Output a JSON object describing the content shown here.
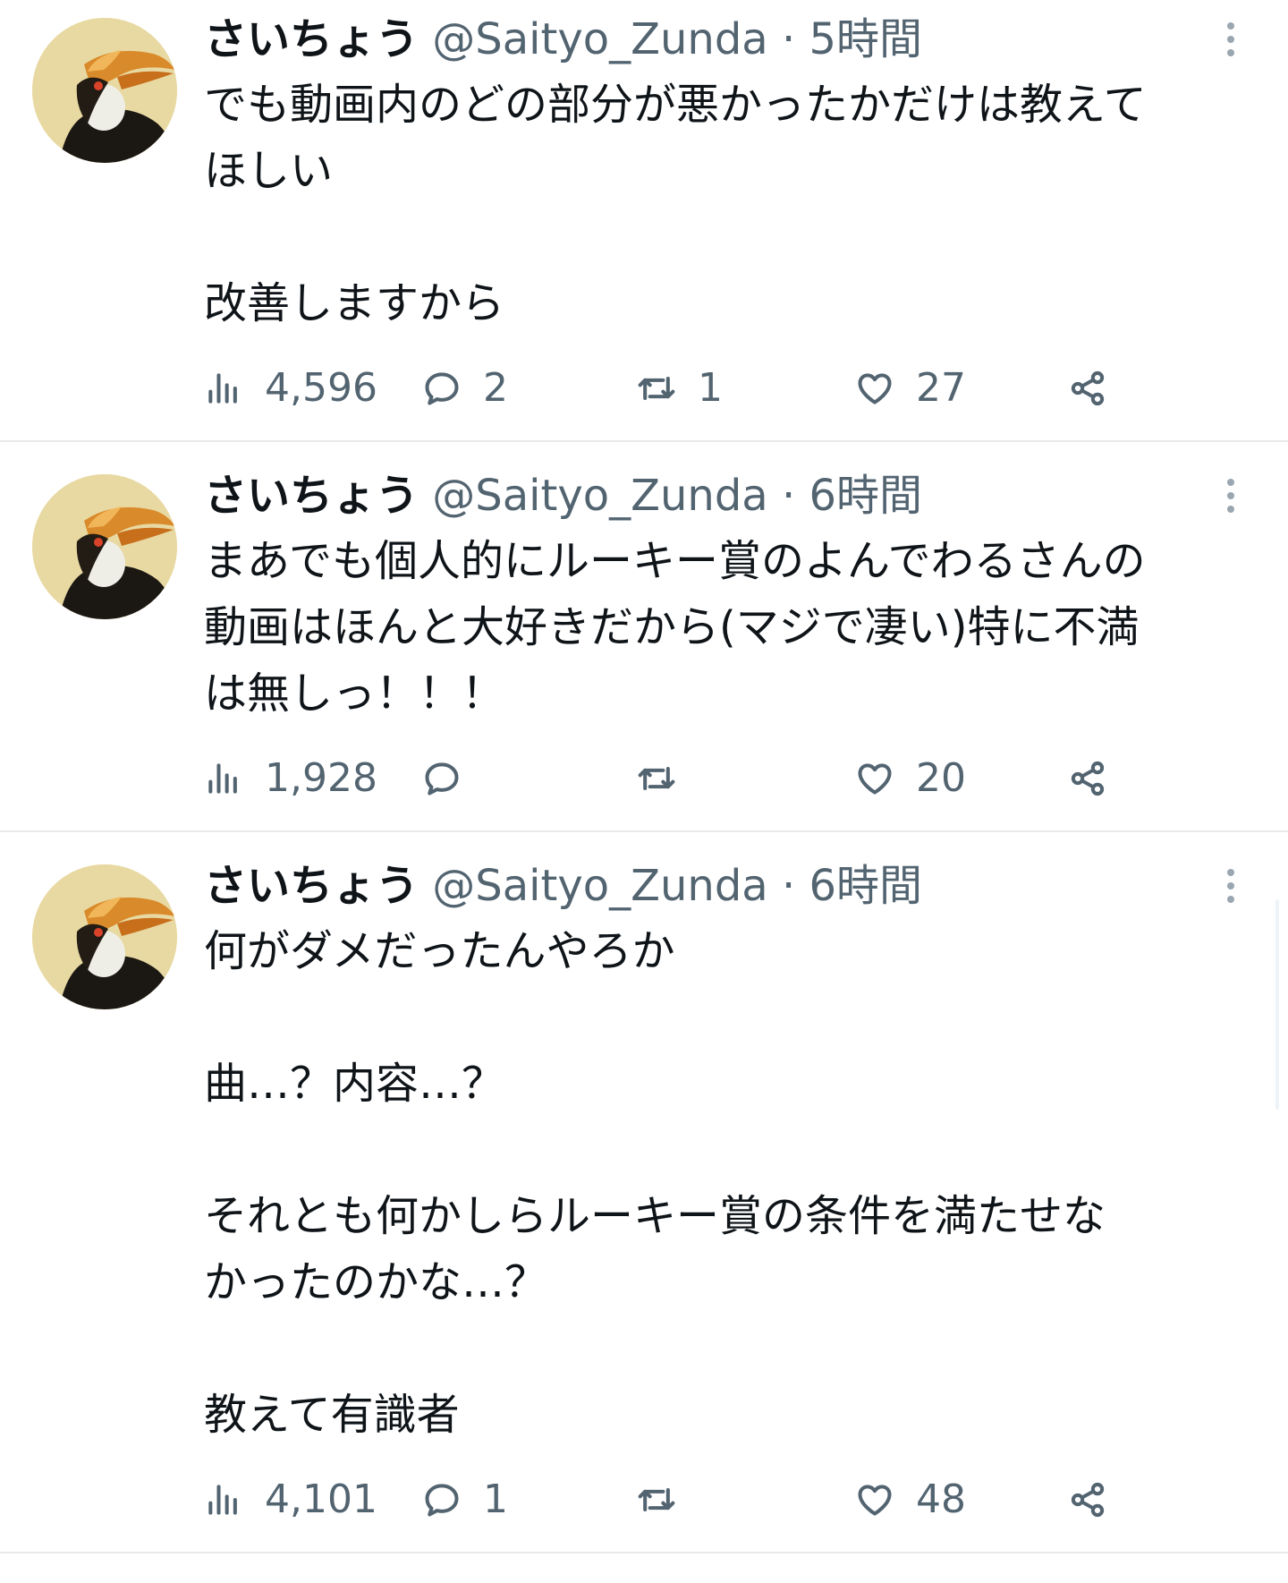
{
  "tweets": [
    {
      "display_name": "さいちょう",
      "handle": "@Saityo_Zunda",
      "separator": "·",
      "time": "5時間",
      "lines": [
        "でも動画内のどの部分が悪かったかだけは教えて",
        "ほしい",
        "",
        "改善しますから"
      ],
      "stats": {
        "views": "4,596",
        "replies": "2",
        "retweets": "1",
        "likes": "27"
      }
    },
    {
      "display_name": "さいちょう",
      "handle": "@Saityo_Zunda",
      "separator": "·",
      "time": "6時間",
      "lines": [
        "まあでも個人的にルーキー賞のよんでわるさんの",
        "動画はほんと大好きだから(マジで凄い)特に不満",
        "は無しっ！！！"
      ],
      "stats": {
        "views": "1,928",
        "replies": "",
        "retweets": "",
        "likes": "20"
      }
    },
    {
      "display_name": "さいちょう",
      "handle": "@Saityo_Zunda",
      "separator": "·",
      "time": "6時間",
      "lines": [
        "何がダメだったんやろか",
        "",
        "曲…？内容…？",
        "",
        "それとも何かしらルーキー賞の条件を満たせな",
        "かったのかな…？",
        "",
        "教えて有識者"
      ],
      "stats": {
        "views": "4,101",
        "replies": "1",
        "retweets": "",
        "likes": "48"
      }
    }
  ],
  "icons": {
    "views": "bar-chart-icon",
    "replies": "speech-bubble-icon",
    "retweets": "retweet-icon",
    "likes": "heart-icon",
    "share": "share-icon",
    "more": "more-vertical-icon"
  },
  "colors": {
    "text": "#0f1419",
    "secondary": "#536471",
    "divider": "#e7e9ea",
    "avatar_bg": "#e8d9a2"
  }
}
